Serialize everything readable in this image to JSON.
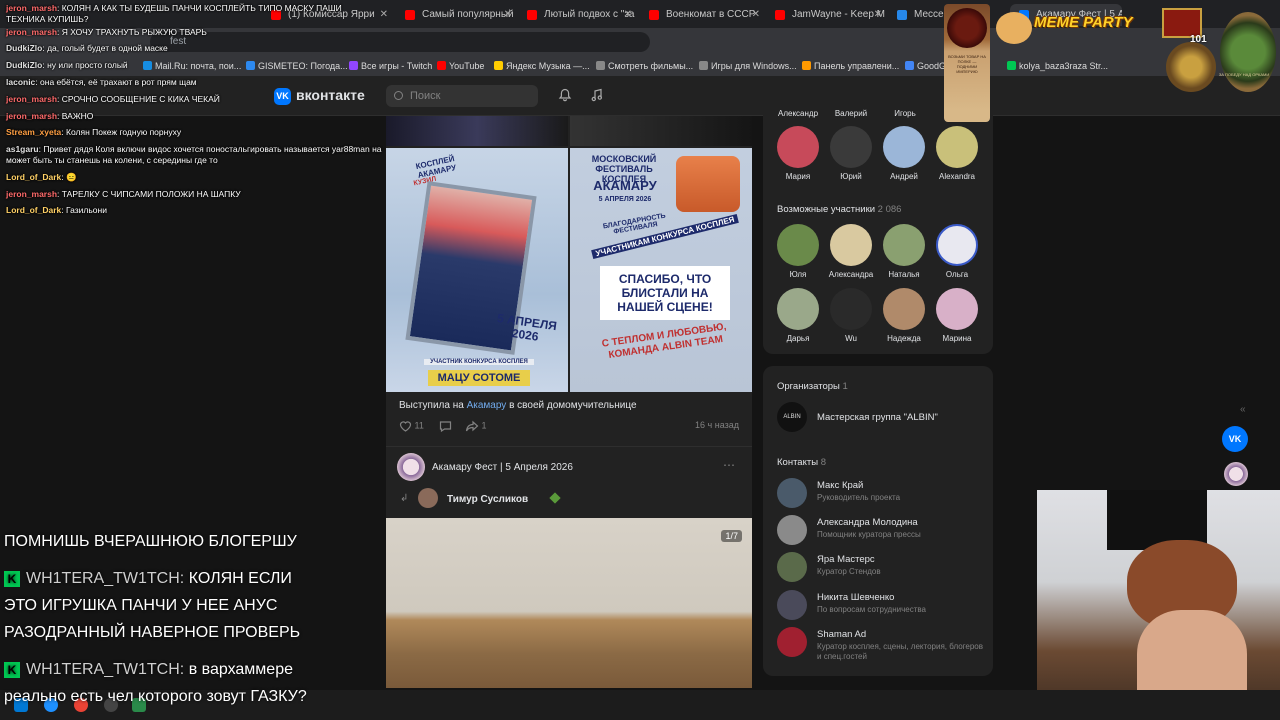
{
  "browser": {
    "tabs": [
      {
        "label": "(1) Комиссар Ярри",
        "color": "#ff0000"
      },
      {
        "label": "Самый популярный",
        "color": "#ff0000"
      },
      {
        "label": "Лютый подвох с \"за",
        "color": "#ff0000"
      },
      {
        "label": "Военкомат в СССР",
        "color": "#ff0000"
      },
      {
        "label": "JamWayne - Keep M",
        "color": "#ff0000"
      },
      {
        "label": "Мессендж",
        "color": "#2688eb"
      },
      {
        "label": "Акамару Фест | 5 А",
        "color": "#0077ff"
      }
    ],
    "address_text": "fest",
    "tab_count": "101",
    "bookmarks": [
      {
        "label": "Mail.Ru: почта, пои...",
        "color": "#168de2"
      },
      {
        "label": "GISMETEO: Погода...",
        "color": "#2d89ef"
      },
      {
        "label": "Все игры - Twitch",
        "color": "#9146ff"
      },
      {
        "label": "YouTube",
        "color": "#ff0000"
      },
      {
        "label": "Яндекс Музыка —...",
        "color": "#ffcc00"
      },
      {
        "label": "Смотреть фильмы...",
        "color": "#888888"
      },
      {
        "label": "Игры для Windows...",
        "color": "#888888"
      },
      {
        "label": "Панель управлени...",
        "color": "#ff9900"
      },
      {
        "label": "GoodGam",
        "color": "#4285f4"
      },
      {
        "label": "kolya_baza3raza Str...",
        "color": "#00c853"
      }
    ]
  },
  "vk": {
    "logo_text": "вконтакте",
    "search_placeholder": "Поиск"
  },
  "chat": [
    {
      "user": "jeron_marsh",
      "text": "КОЛЯН А КАК ТЫ БУДЕШЬ ПАНЧИ КОСПЛЕЙТЬ ТИПО МАСКУ ПАШИ"
    },
    {
      "user": "",
      "text": "ТЕХНИКА КУПИШЬ?"
    },
    {
      "user": "jeron_marsh",
      "text": "Я ХОЧУ ТРАХНУТЬ РЫЖУЮ ТВАРЬ"
    },
    {
      "user": "DudkiZlo",
      "text": "да, голый будет в одной маске"
    },
    {
      "user": "DudkiZlo",
      "text": "ну или просто голый"
    },
    {
      "user": "laconic",
      "text": "она ебётся, её трахают в рот прям щам"
    },
    {
      "user": "jeron_marsh",
      "text": "СРОЧНО СООБЩЕНИЕ С КИКА ЧЕКАЙ"
    },
    {
      "user": "jeron_marsh",
      "text": "ВАЖНО"
    },
    {
      "user": "Stream_xyeta",
      "text": "Колян Покеж годную порнуху"
    },
    {
      "user": "as1garu",
      "text": "Привет дядя Коля включи видос хочется поностальгировать называется yar88man на"
    },
    {
      "user": "",
      "text": "может быть ты станешь на колени, с середины где то"
    },
    {
      "user": "Lord_of_Dark",
      "text": "😑"
    },
    {
      "user": "jeron_marsh",
      "text": "ТАРЕЛКУ С ЧИПСАМИ ПОЛОЖИ НА ШАПКУ"
    },
    {
      "user": "Lord_of_Dark",
      "text": "Газильони"
    }
  ],
  "big_chat": {
    "line0": "ПОМНИШЬ ВЧЕРАШНЮЮ БЛОГЕРШУ",
    "msg1_user": "WH1TERA_TW1TCH:",
    "msg1_text_a": "КОЛЯН ЕСЛИ",
    "msg1_text_b": "ЭТО ИГРУШКА ПАНЧИ У НЕЕ АНУС",
    "msg1_text_c": "РАЗОДРАННЫЙ НАВЕРНОЕ ПРОВЕРЬ",
    "msg2_user": "WH1TERA_TW1TCH:",
    "msg2_text_a": "в вархаммере",
    "msg2_text_b": "реально есть чел которого зовут ГАЗКУ?"
  },
  "feed": {
    "poster1": {
      "top": "КОСПЛЕЙ АКАМАРУ",
      "sub": "КУЗИЛ",
      "date": "5 АПРЕЛЯ 2026",
      "banner": "УЧАСТНИК КОНКУРСА КОСПЛЕЯ",
      "name": "МАЦУ СОТОМЕ"
    },
    "poster2": {
      "top": "МОСКОВСКИЙ ФЕСТИВАЛЬ КОСПЛЕЯ",
      "name": "АКАМАРУ",
      "date": "5 АПРЕЛЯ 2026",
      "l1": "БЛАГОДАРНОСТЬ ФЕСТИВАЛЯ",
      "l2": "УЧАСТНИКАМ КОНКУРСА КОСПЛЕЯ",
      "l3": "СПАСИБО, ЧТО БЛИСТАЛИ НА НАШЕЙ СЦЕНЕ!",
      "l4": "С ТЕПЛОМ И ЛЮБОВЬЮ, КОМАНДА ALBIN TEAM"
    },
    "caption_pre": "Выступила на",
    "caption_link": "Акамару",
    "caption_post": "в своей домомучительнице",
    "likes": "11",
    "shares": "1",
    "time": "16 ч назад",
    "post2_author": "Акамару Фест | 5 Апреля 2026",
    "post2_repost_user": "Тимур Сусликов",
    "photo_counter": "1/7"
  },
  "right": {
    "friends_top_labels": [
      "Александр",
      "Валерий",
      "Игорь"
    ],
    "friends": [
      {
        "name": "Мария",
        "color": "#c74a5a"
      },
      {
        "name": "Юрий",
        "color": "#3a3a3a"
      },
      {
        "name": "Андрей",
        "color": "#9bb6d8"
      },
      {
        "name": "Alexandra",
        "color": "#c9c07a"
      }
    ],
    "possible_title": "Возможные участники",
    "possible_count": "2 086",
    "possible": [
      {
        "name": "Юля",
        "color": "#6a8a4a"
      },
      {
        "name": "Александра",
        "color": "#d9c9a0"
      },
      {
        "name": "Наталья",
        "color": "#8aa070"
      },
      {
        "name": "Ольга",
        "color": "#e8e8f0"
      },
      {
        "name": "Дарья",
        "color": "#9aa88a"
      },
      {
        "name": "Wu",
        "color": "#2a2a2a"
      },
      {
        "name": "Надежда",
        "color": "#b08a6a"
      },
      {
        "name": "Марина",
        "color": "#d8b0c8"
      }
    ],
    "organizers_title": "Организаторы",
    "organizers_count": "1",
    "organizer_logo": "ALBIN",
    "organizer_name": "Мастерская группа \"ALBIN\"",
    "contacts_title": "Контакты",
    "contacts_count": "8",
    "contacts": [
      {
        "name": "Макс Край",
        "role": "Руководитель проекта",
        "color": "#4a5a6a"
      },
      {
        "name": "Александра Молодина",
        "role": "Помощник куратора прессы",
        "color": "#8a8a8a"
      },
      {
        "name": "Яра Мастерс",
        "role": "Куратор Стендов",
        "color": "#5a6a4a"
      },
      {
        "name": "Никита Шевченко",
        "role": "По вопросам сотрудничества",
        "color": "#4a4a5a"
      },
      {
        "name": "Shaman Ad",
        "role": "Куратор косплея, сцены, лектория, блогеров и спец.гостей",
        "color": "#a02030"
      }
    ]
  },
  "meme_text": "MEME PARTY",
  "stamp_text": "ВОЗЬМИ ТОВАР НА ПОЛКЕ — ПОДНИМИ ИМПЕРИЮ",
  "badge_text": "ЗА ПОБЕДУ НАД ОРКАМИ",
  "colors": {
    "vk_blue": "#0077ff",
    "link": "#71aaeb",
    "panel": "#222222",
    "bg": "#141414"
  }
}
